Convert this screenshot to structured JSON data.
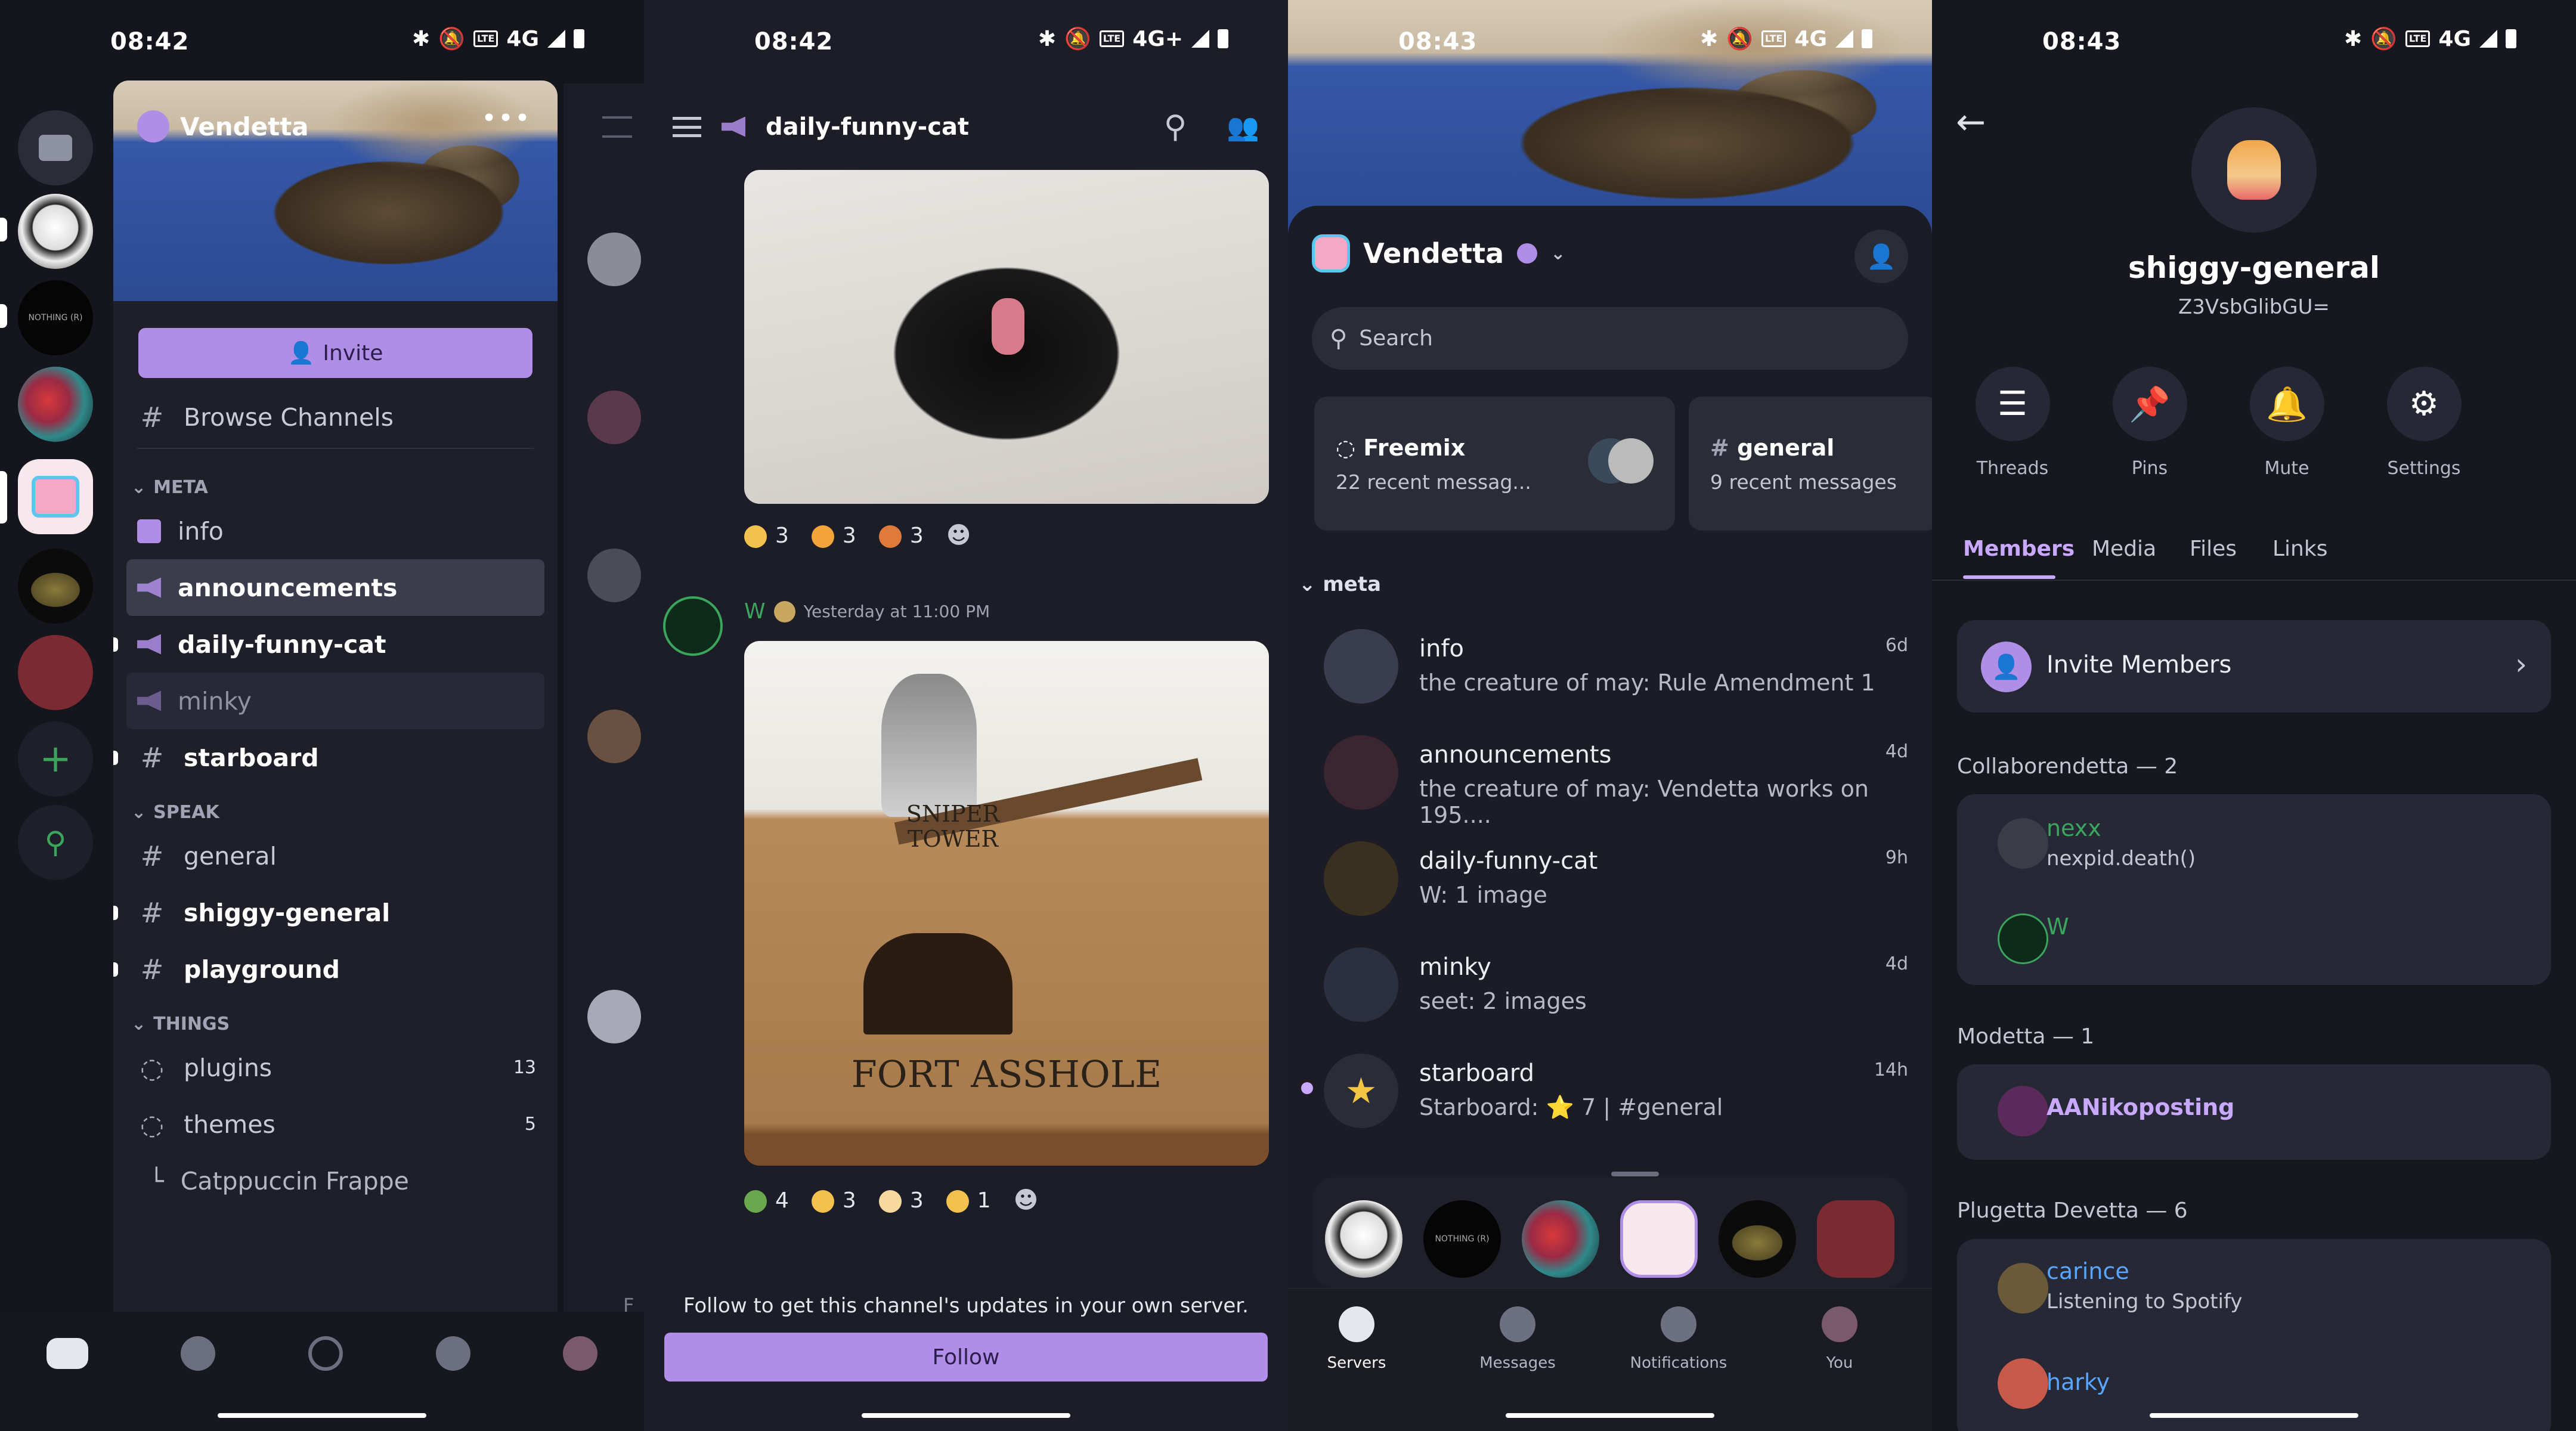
{
  "status_bars": [
    {
      "time": "08:42",
      "network": "4G"
    },
    {
      "time": "08:42",
      "network": "4G+"
    },
    {
      "time": "08:43",
      "network": "4G"
    },
    {
      "time": "08:43",
      "network": "4G"
    }
  ],
  "panel1": {
    "server_name": "Vendetta",
    "more_label": "•••",
    "invite_label": "Invite",
    "browse_channels": "Browse Channels",
    "categories": [
      {
        "name": "META",
        "channels": [
          {
            "name": "info",
            "style": "normal"
          },
          {
            "name": "announcements",
            "style": "selected"
          },
          {
            "name": "daily-funny-cat",
            "style": "unread"
          },
          {
            "name": "minky",
            "style": "muted"
          },
          {
            "name": "starboard",
            "style": "unread"
          }
        ]
      },
      {
        "name": "SPEAK",
        "channels": [
          {
            "name": "general",
            "style": "normal"
          },
          {
            "name": "shiggy-general",
            "style": "unread"
          },
          {
            "name": "playground",
            "style": "unread"
          }
        ]
      },
      {
        "name": "THINGS",
        "channels": [
          {
            "name": "plugins",
            "count": "13"
          },
          {
            "name": "themes",
            "count": "5"
          },
          {
            "name": "Catppuccin Frappe",
            "count": ""
          }
        ]
      }
    ],
    "server_badge_text": "NOTHING (R)"
  },
  "panel2": {
    "channel_name": "daily-funny-cat",
    "reactions_1": [
      {
        "count": "3",
        "color": "#f2c14e"
      },
      {
        "count": "3",
        "color": "#f4a43a"
      },
      {
        "count": "3",
        "color": "#e07a3a"
      }
    ],
    "message": {
      "author": "W",
      "timestamp": "Yesterday at 11:00 PM"
    },
    "image_text": {
      "top1": "SNIPER",
      "top2": "TOWER",
      "bottom": "FORT ASSHOLE"
    },
    "reactions_2": [
      {
        "count": "4",
        "color": "#6aa84f"
      },
      {
        "count": "3",
        "color": "#f2c14e"
      },
      {
        "count": "3",
        "color": "#f7d9a0"
      },
      {
        "count": "1",
        "color": "#f2c14e"
      }
    ],
    "follow_text": "Follow to get this channel's updates in your own server.",
    "follow_button": "Follow",
    "peek_letter": "F"
  },
  "panel3": {
    "server_name": "Vendetta",
    "search_placeholder": "Search",
    "cards": [
      {
        "title": "Freemix",
        "subtitle": "22 recent messag..."
      },
      {
        "title": "general",
        "subtitle": "9 recent messages"
      }
    ],
    "category": "meta",
    "channels": [
      {
        "name": "info",
        "preview": "the creature of may: Rule Amendment 1",
        "time": "6d"
      },
      {
        "name": "announcements",
        "preview": "the creature of may: Vendetta works on 195....",
        "time": "4d"
      },
      {
        "name": "daily-funny-cat",
        "preview": "W: 1 image",
        "time": "9h"
      },
      {
        "name": "minky",
        "preview": "seet: 2 images",
        "time": "4d"
      },
      {
        "name": "starboard",
        "preview": "Starboard: ⭐ 7 | #general",
        "time": "14h"
      }
    ],
    "dock_badge": "NOTHING (R)",
    "nav": [
      "Servers",
      "Messages",
      "Notifications",
      "You"
    ]
  },
  "panel4": {
    "channel_name": "shiggy-general",
    "channel_id": "Z3VsbGlibGU=",
    "actions": [
      "Threads",
      "Pins",
      "Mute",
      "Settings"
    ],
    "tabs": [
      "Members",
      "Media",
      "Files",
      "Links"
    ],
    "invite_members": "Invite Members",
    "groups": [
      {
        "name": "Collaborendetta — 2"
      },
      {
        "name": "Modetta — 1"
      },
      {
        "name": "Plugetta Devetta — 6"
      }
    ],
    "members": [
      {
        "name": "nexx",
        "status": "nexpid.death()",
        "color": "#3ba55d"
      },
      {
        "name": "W",
        "status": "",
        "color": "#3ba55d"
      },
      {
        "name": "AANikoposting",
        "status": "",
        "color": "#c9a8ff"
      },
      {
        "name": "carince",
        "status": "Listening to Spotify",
        "color": "#58a6ff"
      },
      {
        "name": "harky",
        "status": "",
        "color": "#58a6ff"
      }
    ]
  },
  "colors": {
    "accent": "#b08ee8",
    "background": "#16171f",
    "surface": "#262835"
  }
}
